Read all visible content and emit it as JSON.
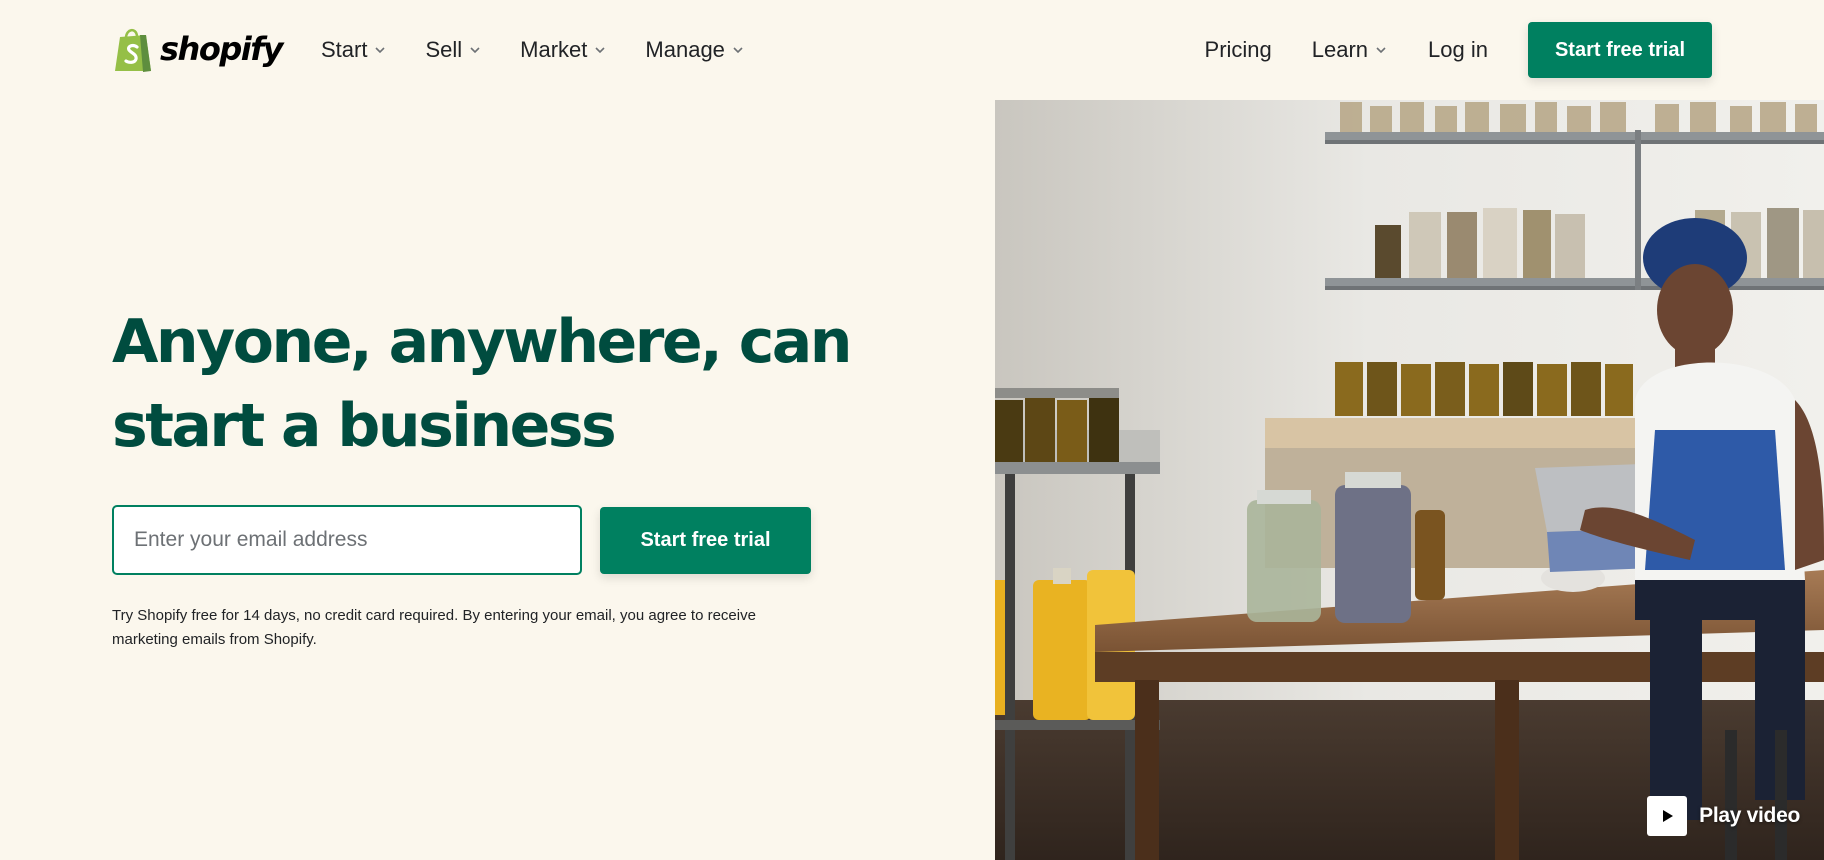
{
  "brand": {
    "name": "shopify",
    "accent": "#008060",
    "heading_color": "#004c3f",
    "background": "#fbf7ed"
  },
  "nav": {
    "left": [
      {
        "label": "Start",
        "has_dropdown": true
      },
      {
        "label": "Sell",
        "has_dropdown": true
      },
      {
        "label": "Market",
        "has_dropdown": true
      },
      {
        "label": "Manage",
        "has_dropdown": true
      }
    ],
    "pricing": "Pricing",
    "learn": "Learn",
    "login": "Log in",
    "cta": "Start free trial"
  },
  "hero": {
    "title_line1": "Anyone, anywhere, can",
    "title_line2": "start a business",
    "email_placeholder": "Enter your email address",
    "email_value": "",
    "cta": "Start free trial",
    "disclaimer_line1": "Try Shopify free for 14 days, no credit card required. By entering your email, you agree to receive",
    "disclaimer_line2": "marketing emails from Shopify."
  },
  "media": {
    "play_label": "Play video",
    "play_icon": "play-icon"
  }
}
